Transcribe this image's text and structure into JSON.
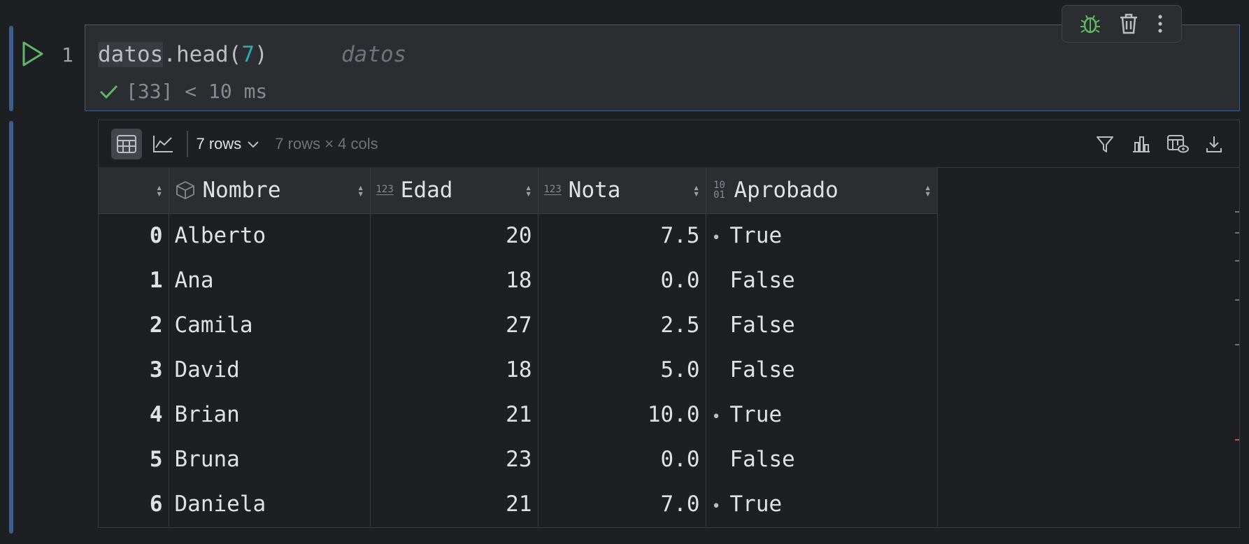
{
  "editor": {
    "line_number": "1",
    "code_var": "datos",
    "code_method": ".head(",
    "code_arg": "7",
    "code_close": ")",
    "inline_hint": "datos",
    "exec_status": "[33] < 10 ms"
  },
  "cell_toolbar": {
    "icons": [
      "debug-icon",
      "trash-icon",
      "more-vertical-icon"
    ]
  },
  "output_toolbar": {
    "rows_dropdown": "7 rows",
    "shape_text": "7 rows × 4 cols"
  },
  "table": {
    "columns": [
      {
        "name": "Nombre",
        "type_icon": "object-type-icon"
      },
      {
        "name": "Edad",
        "type_icon": "numeric-type-icon",
        "type_label": "123"
      },
      {
        "name": "Nota",
        "type_icon": "numeric-type-icon",
        "type_label": "123"
      },
      {
        "name": "Aprobado",
        "type_icon": "boolean-type-icon",
        "type_label": "10 01"
      }
    ],
    "rows": [
      {
        "index": "0",
        "nombre": "Alberto",
        "edad": "20",
        "nota": "7.5",
        "aprobado": "True"
      },
      {
        "index": "1",
        "nombre": "Ana",
        "edad": "18",
        "nota": "0.0",
        "aprobado": "False"
      },
      {
        "index": "2",
        "nombre": "Camila",
        "edad": "27",
        "nota": "2.5",
        "aprobado": "False"
      },
      {
        "index": "3",
        "nombre": "David",
        "edad": "18",
        "nota": "5.0",
        "aprobado": "False"
      },
      {
        "index": "4",
        "nombre": "Brian",
        "edad": "21",
        "nota": "10.0",
        "aprobado": "True"
      },
      {
        "index": "5",
        "nombre": "Bruna",
        "edad": "23",
        "nota": "0.0",
        "aprobado": "False"
      },
      {
        "index": "6",
        "nombre": "Daniela",
        "edad": "21",
        "nota": "7.0",
        "aprobado": "True"
      }
    ],
    "true_marker": "•"
  },
  "colors": {
    "accent": "#3d5f8f",
    "run_green": "#5fb865",
    "check_green": "#5fb865",
    "debug_green": "#5fb865"
  }
}
